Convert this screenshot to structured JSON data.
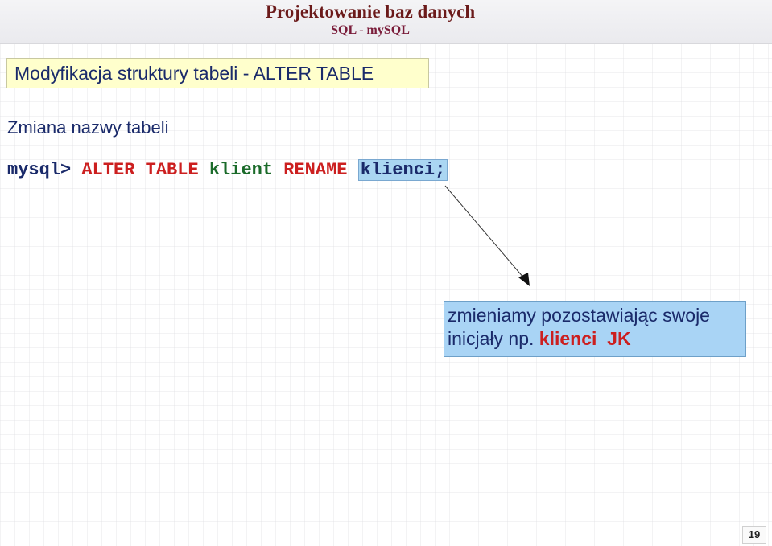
{
  "header": {
    "title": "Projektowanie baz danych",
    "subtitle": "SQL - mySQL"
  },
  "section": {
    "title": "Modyfikacja struktury tabeli  - ALTER TABLE"
  },
  "content": {
    "subheading": "Zmiana nazwy tabeli",
    "command": {
      "prompt": "mysql> ",
      "kw1": "ALTER TABLE ",
      "table": "klient ",
      "kw2": "RENAME ",
      "new_name": "klienci;"
    }
  },
  "note": {
    "text": "zmieniamy pozostawiając swoje inicjały np. ",
    "highlight": "klienci_JK"
  },
  "page_number": "19"
}
